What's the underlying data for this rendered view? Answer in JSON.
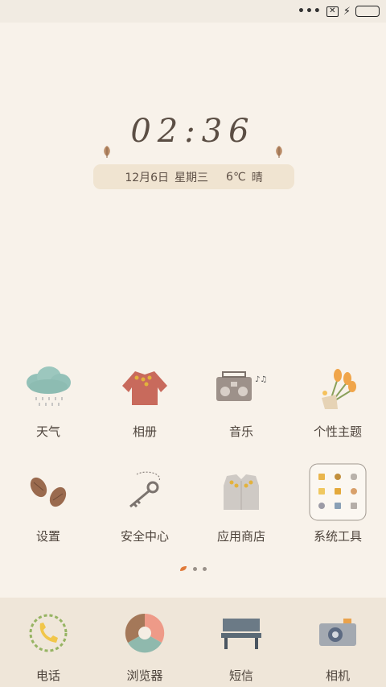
{
  "status_bar": {
    "more": "•••"
  },
  "lock": {
    "time": "02:36",
    "date": "12月6日",
    "weekday": "星期三",
    "temperature": "6℃",
    "weather": "晴"
  },
  "apps": [
    {
      "label": "天气",
      "icon": "cloud-rain-icon"
    },
    {
      "label": "相册",
      "icon": "sweater-icon"
    },
    {
      "label": "音乐",
      "icon": "radio-icon"
    },
    {
      "label": "个性主题",
      "icon": "flowers-icon"
    },
    {
      "label": "设置",
      "icon": "pinecone-icon"
    },
    {
      "label": "安全中心",
      "icon": "key-icon"
    },
    {
      "label": "应用商店",
      "icon": "cardigan-icon"
    },
    {
      "label": "系统工具",
      "icon": "folder-icon"
    }
  ],
  "dock": [
    {
      "label": "电话",
      "icon": "phone-icon"
    },
    {
      "label": "浏览器",
      "icon": "browser-icon"
    },
    {
      "label": "短信",
      "icon": "bench-icon"
    },
    {
      "label": "相机",
      "icon": "camera-icon"
    }
  ],
  "colors": {
    "background": "#f8f2ea",
    "battery": "#3fb52a",
    "date_pill": "#f0e4d1"
  }
}
